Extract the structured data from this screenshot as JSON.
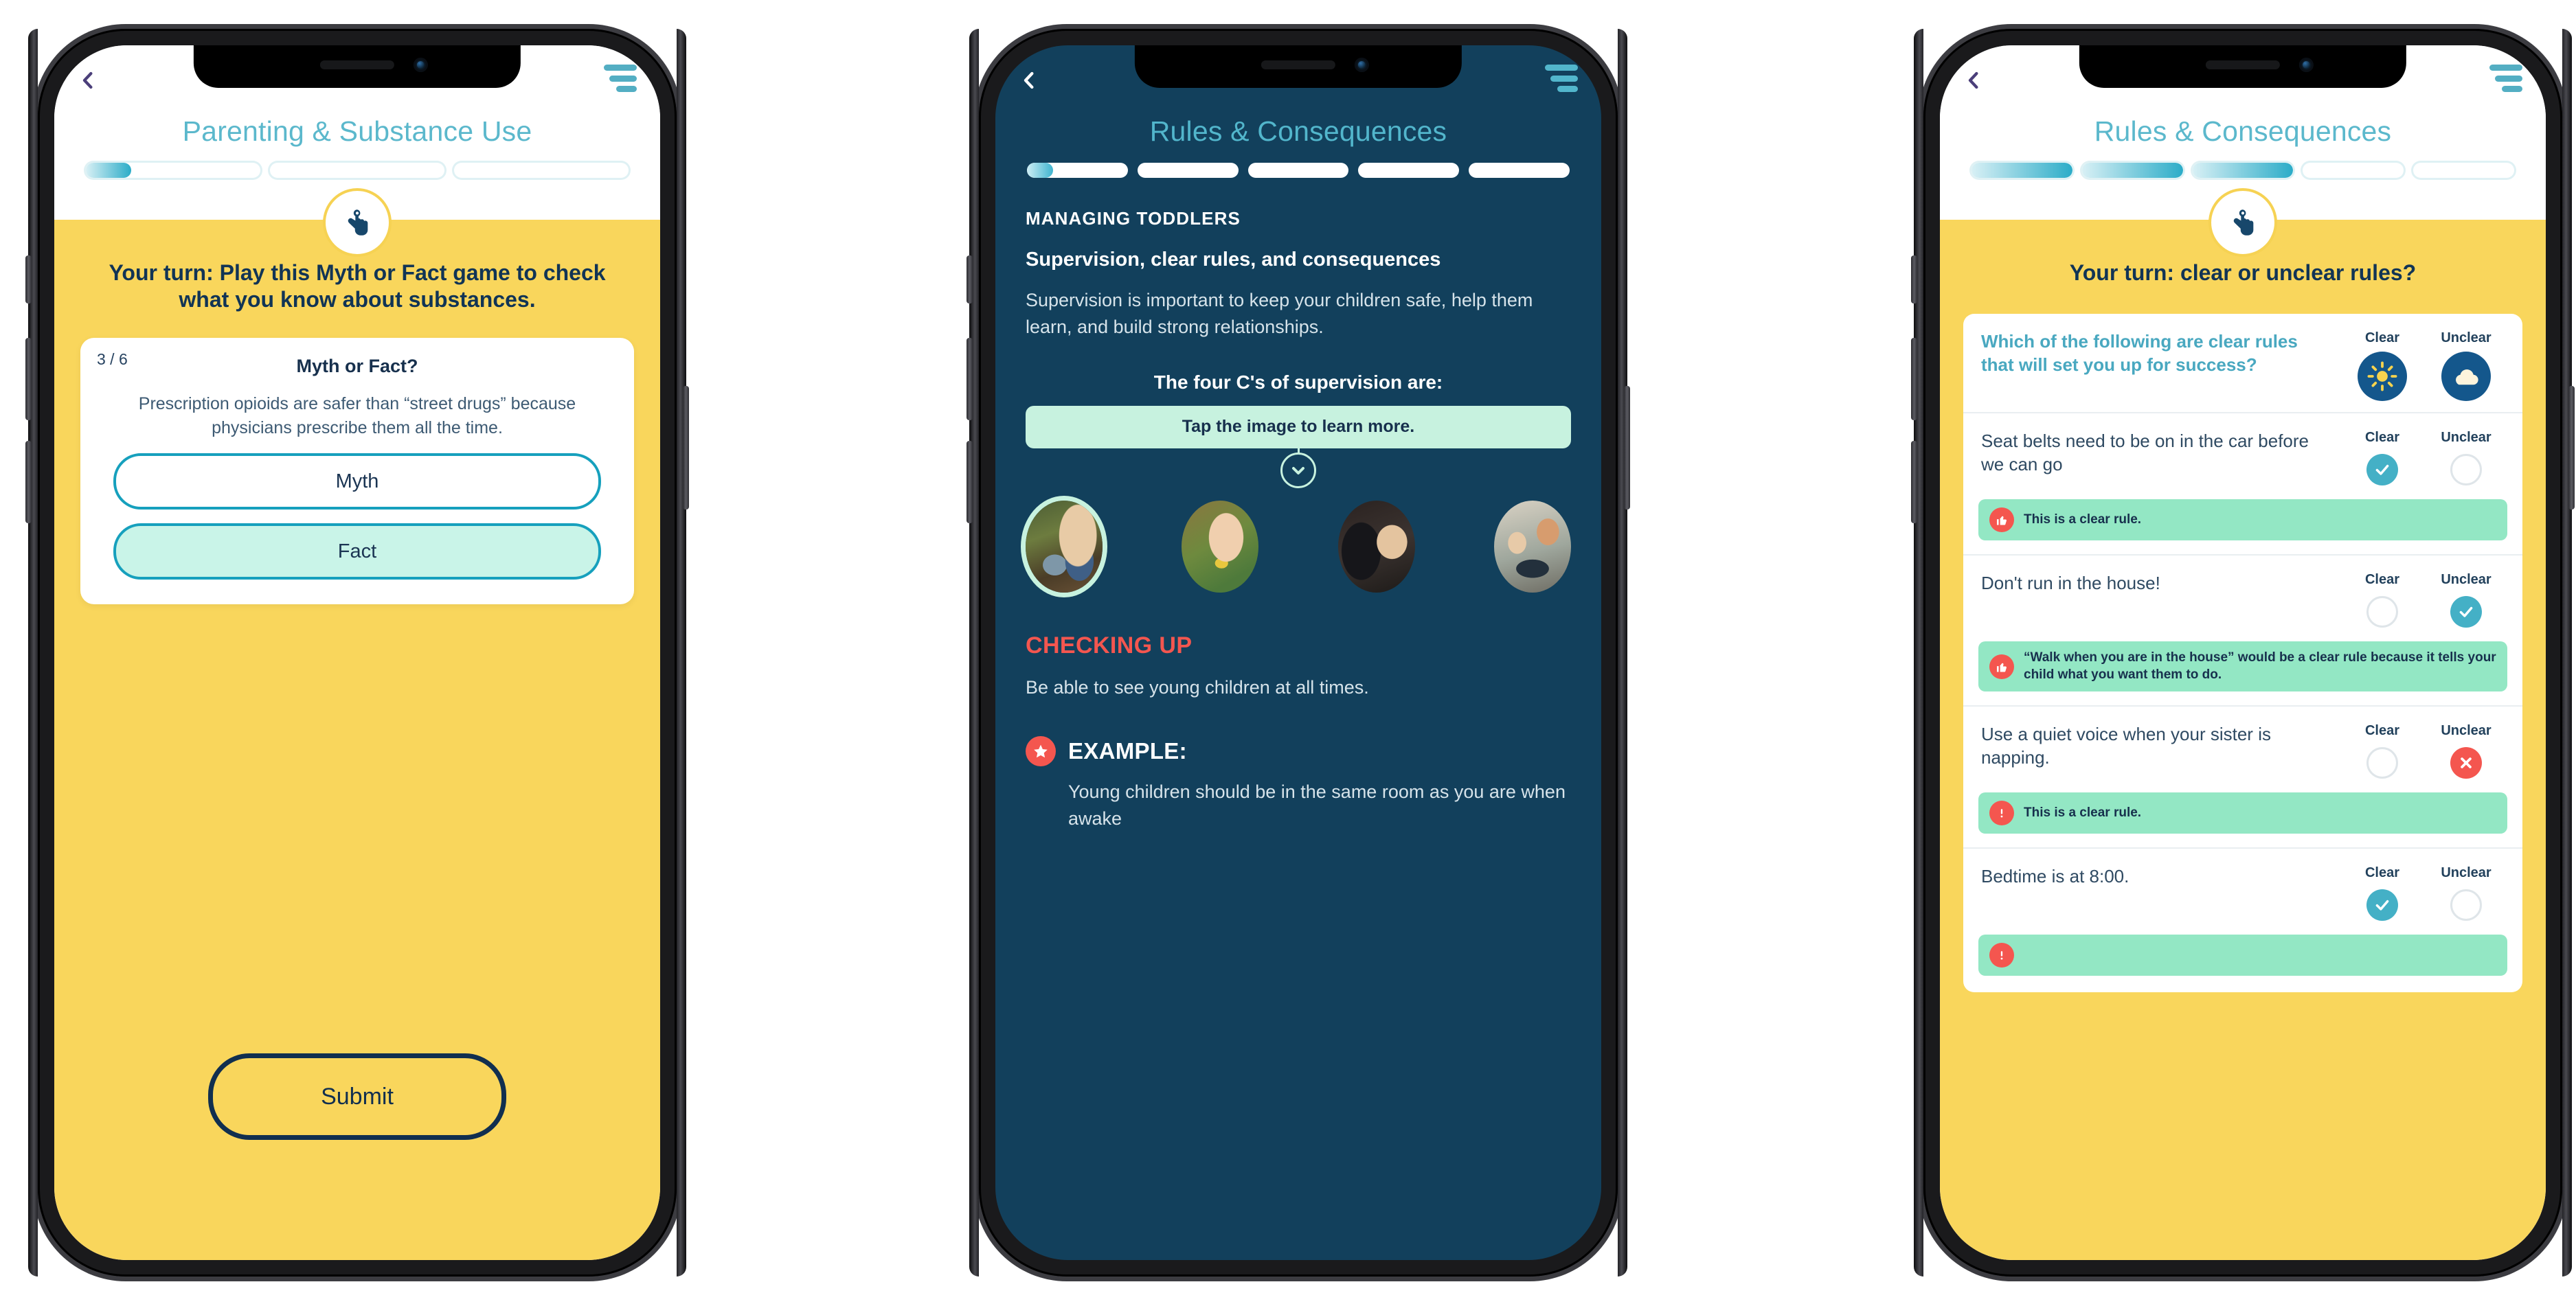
{
  "phone1": {
    "app_title": "Parenting & Substance Use",
    "back_icon": "chevron-left-icon",
    "menu_icon": "hamburger-menu-icon",
    "badge_icon": "tap-hand-icon",
    "progress": {
      "segments": 3,
      "fills": [
        0.26,
        0,
        0
      ]
    },
    "prompt": "Your turn: Play this Myth or Fact game to check what you know about substances.",
    "card": {
      "counter": "3 / 6",
      "title": "Myth or Fact?",
      "question": "Prescription opioids are safer than “street drugs” because physicians prescribe them all the time.",
      "choices": [
        {
          "label": "Myth",
          "selected": false
        },
        {
          "label": "Fact",
          "selected": true
        }
      ]
    },
    "submit_label": "Submit"
  },
  "phone2": {
    "app_title": "Rules & Consequences",
    "back_icon": "chevron-left-icon",
    "menu_icon": "hamburger-menu-icon",
    "progress": {
      "segments": 5,
      "fills": [
        0.26,
        0,
        0,
        0,
        0
      ]
    },
    "kicker": "MANAGING TODDLERS",
    "heading": "Supervision, clear rules, and consequences",
    "paragraph": "Supervision is important to keep your children safe, help them learn, and build strong relationships.",
    "lead": "The four C's of supervision are:",
    "tap_pill": "Tap the image to learn more.",
    "caret_icon": "chevron-down-icon",
    "thumbnails": [
      {
        "name": "child-watering-plants-photo",
        "active": true
      },
      {
        "name": "child-with-paint-photo",
        "active": false
      },
      {
        "name": "parent-hugging-child-photo",
        "active": false
      },
      {
        "name": "mother-with-two-children-tablet-photo",
        "active": false
      }
    ],
    "section_title": "CHECKING UP",
    "section_body": "Be able to see young children at all times.",
    "example_icon": "star-icon",
    "example_label": "EXAMPLE:",
    "example_body": "Young children should be in the same room as you are when awake"
  },
  "phone3": {
    "app_title": "Rules & Consequences",
    "back_icon": "chevron-left-icon",
    "menu_icon": "hamburger-menu-icon",
    "badge_icon": "tap-hand-icon",
    "progress": {
      "segments": 5,
      "fills": [
        1,
        1,
        1,
        0,
        0
      ]
    },
    "prompt": "Your turn: clear or unclear rules?",
    "columns": [
      "Clear",
      "Unclear"
    ],
    "quiz": {
      "header": {
        "question": "Which of the following are clear rules that will set you up for success?",
        "clear_icon": "sun-icon",
        "unclear_icon": "cloud-icon"
      },
      "rows": [
        {
          "text": "Seat belts need to be on in the car before we can go",
          "clear_state": "check",
          "unclear_state": "empty",
          "feedback": {
            "icon": "thumbs-up-icon",
            "text": "This is a clear rule."
          }
        },
        {
          "text": "Don't run in the house!",
          "clear_state": "empty",
          "unclear_state": "check",
          "feedback": {
            "icon": "thumbs-up-icon",
            "text": "“Walk when you are in the house” would be a clear rule because it tells your child what you want them to do."
          }
        },
        {
          "text": "Use a quiet voice when your sister is napping.",
          "clear_state": "empty",
          "unclear_state": "cross",
          "feedback": {
            "icon": "exclamation-icon",
            "text": "This is a clear rule."
          }
        },
        {
          "text": "Bedtime is at 8:00.",
          "clear_state": "check",
          "unclear_state": "empty",
          "feedback": {
            "icon": "exclamation-icon",
            "text": ""
          }
        }
      ]
    }
  },
  "colors": {
    "yellow": "#f9d65c",
    "navy": "#12405c",
    "teal": "#52b6cc",
    "mint": "#c7f2df",
    "green": "#93e7c4",
    "red": "#f4564f",
    "check_blue": "#44b0c6",
    "dark_text": "#17304d"
  }
}
